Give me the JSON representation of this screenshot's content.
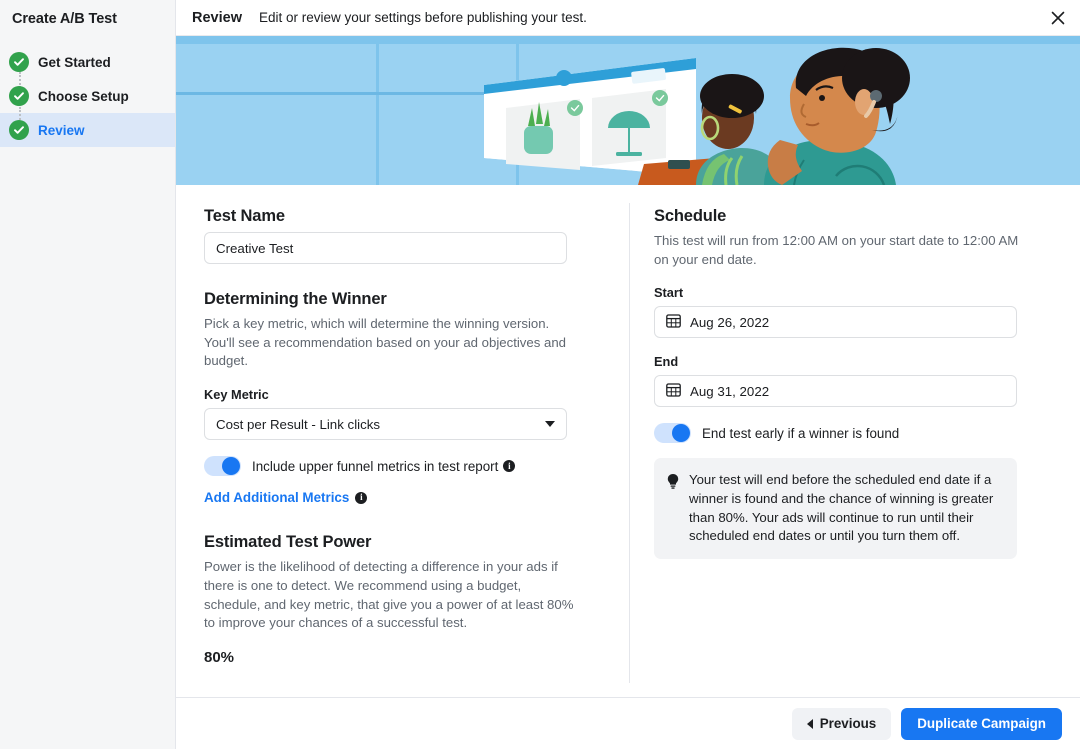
{
  "sidebar": {
    "title": "Create A/B Test",
    "items": [
      {
        "label": "Get Started",
        "state": "complete"
      },
      {
        "label": "Choose Setup",
        "state": "complete"
      },
      {
        "label": "Review",
        "state": "active"
      }
    ]
  },
  "topbar": {
    "title": "Review",
    "subtitle": "Edit or review your settings before publishing your test.",
    "close_icon": "close-icon"
  },
  "hero": {
    "alt": "Illustration of two people reviewing ad creatives on a whiteboard",
    "background_color": "#9ad2f2"
  },
  "left": {
    "test_name": {
      "heading": "Test Name",
      "value": "Creative Test",
      "placeholder": "Test name"
    },
    "winner": {
      "heading": "Determining the Winner",
      "description": "Pick a key metric, which will determine the winning version. You'll see a recommendation based on your ad objectives and budget.",
      "key_metric_label": "Key Metric",
      "key_metric_value": "Cost per Result - Link clicks",
      "toggle_label": "Include upper funnel metrics in test report",
      "toggle_on": true,
      "add_metrics_link": "Add Additional Metrics"
    },
    "power": {
      "heading": "Estimated Test Power",
      "description": "Power is the likelihood of detecting a difference in your ads if there is one to detect. We recommend using a budget, schedule, and key metric, that give you a power of at least 80% to improve your chances of a successful test.",
      "value": "80%"
    }
  },
  "right": {
    "schedule": {
      "heading": "Schedule",
      "description": "This test will run from 12:00 AM on your start date to 12:00 AM on your end date.",
      "start_label": "Start",
      "start_value": "Aug 26, 2022",
      "end_label": "End",
      "end_value": "Aug 31, 2022",
      "toggle_label": "End test early if a winner is found",
      "toggle_on": true,
      "notice": "Your test will end before the scheduled end date if a winner is found and the chance of winning is greater than 80%. Your ads will continue to run until their scheduled end dates or until you turn them off."
    }
  },
  "footer": {
    "previous_label": "Previous",
    "duplicate_label": "Duplicate Campaign"
  },
  "colors": {
    "accent": "#1877f2",
    "success": "#31a24c",
    "sidebar_bg": "#f5f6f7",
    "active_bg": "#dbe7f8",
    "notice_bg": "#f2f3f5"
  }
}
